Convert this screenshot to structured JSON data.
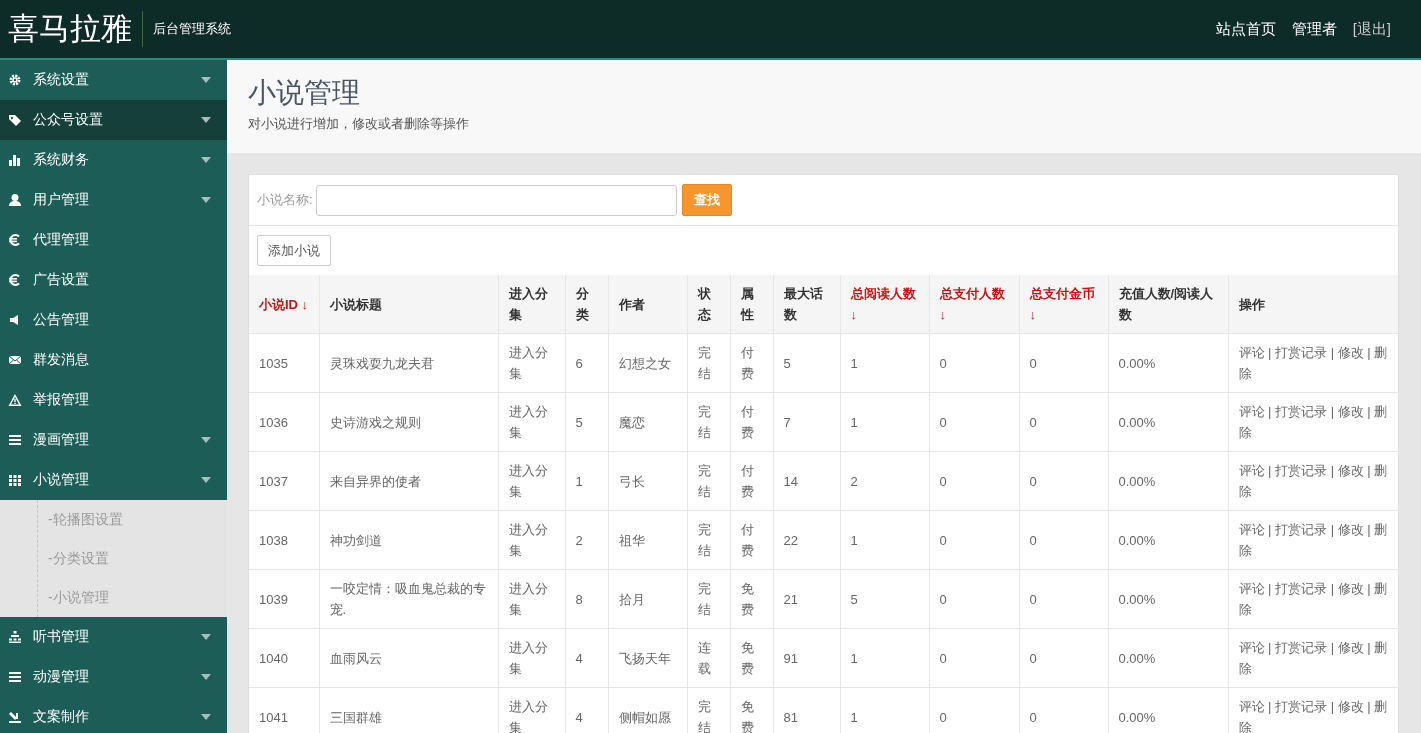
{
  "header": {
    "logo": "喜马拉雅",
    "subtitle": "后台管理系统",
    "links": [
      "站点首页",
      "管理者",
      "[退出]"
    ]
  },
  "sidebar": {
    "items": [
      {
        "label": "系统设置",
        "expandable": true,
        "selected": false
      },
      {
        "label": "公众号设置",
        "expandable": true,
        "selected": true
      },
      {
        "label": "系统财务",
        "expandable": true,
        "selected": false
      },
      {
        "label": "用户管理",
        "expandable": true,
        "selected": false
      },
      {
        "label": "代理管理",
        "expandable": false,
        "selected": false
      },
      {
        "label": "广告设置",
        "expandable": false,
        "selected": false
      },
      {
        "label": "公告管理",
        "expandable": false,
        "selected": false
      },
      {
        "label": "群发消息",
        "expandable": false,
        "selected": false
      },
      {
        "label": "举报管理",
        "expandable": false,
        "selected": false
      },
      {
        "label": "漫画管理",
        "expandable": true,
        "selected": false
      },
      {
        "label": "小说管理",
        "expandable": true,
        "selected": false,
        "expanded": true,
        "children": [
          {
            "label": "-轮播图设置"
          },
          {
            "label": "-分类设置"
          },
          {
            "label": "-小说管理"
          }
        ]
      },
      {
        "label": "听书管理",
        "expandable": true,
        "selected": false
      },
      {
        "label": "动漫管理",
        "expandable": true,
        "selected": false
      },
      {
        "label": "文案制作",
        "expandable": true,
        "selected": false
      }
    ]
  },
  "page": {
    "title": "小说管理",
    "description": "对小说进行增加，修改或者删除等操作"
  },
  "search": {
    "label": "小说名称:",
    "button": "查找"
  },
  "add_button": "添加小说",
  "table": {
    "columns": [
      {
        "label": "小说ID ↓",
        "sortable": true
      },
      {
        "label": "小说标题",
        "sortable": false
      },
      {
        "label": "进入分集",
        "sortable": false
      },
      {
        "label": "分类",
        "sortable": false
      },
      {
        "label": "作者",
        "sortable": false
      },
      {
        "label": "状态",
        "sortable": false
      },
      {
        "label": "属性",
        "sortable": false
      },
      {
        "label": "最大话数",
        "sortable": false
      },
      {
        "label": "总阅读人数 ↓",
        "sortable": true
      },
      {
        "label": "总支付人数 ↓",
        "sortable": true
      },
      {
        "label": "总支付金币 ↓",
        "sortable": true
      },
      {
        "label": "充值人数/阅读人数",
        "sortable": false
      },
      {
        "label": "操作",
        "sortable": false
      }
    ],
    "rows": [
      [
        "1035",
        "灵珠戏耍九龙夫君",
        "进入分集",
        "6",
        "幻想之女",
        "完结",
        "付费",
        "5",
        "1",
        "0",
        "0",
        "0.00%",
        "评论 | 打赏记录 | 修改 | 删除"
      ],
      [
        "1036",
        "史诗游戏之规则",
        "进入分集",
        "5",
        "魔恋",
        "完结",
        "付费",
        "7",
        "1",
        "0",
        "0",
        "0.00%",
        "评论 | 打赏记录 | 修改 | 删除"
      ],
      [
        "1037",
        "来自异界的使者",
        "进入分集",
        "1",
        "弓长",
        "完结",
        "付费",
        "14",
        "2",
        "0",
        "0",
        "0.00%",
        "评论 | 打赏记录 | 修改 | 删除"
      ],
      [
        "1038",
        "神功剑道",
        "进入分集",
        "2",
        "祖华",
        "完结",
        "付费",
        "22",
        "1",
        "0",
        "0",
        "0.00%",
        "评论 | 打赏记录 | 修改 | 删除"
      ],
      [
        "1039",
        "一咬定情：吸血鬼总裁的专宠.",
        "进入分集",
        "8",
        "拾月",
        "完结",
        "免费",
        "21",
        "5",
        "0",
        "0",
        "0.00%",
        "评论 | 打赏记录 | 修改 | 删除"
      ],
      [
        "1040",
        "血雨风云",
        "进入分集",
        "4",
        "飞扬天年",
        "连载",
        "免费",
        "91",
        "1",
        "0",
        "0",
        "0.00%",
        "评论 | 打赏记录 | 修改 | 删除"
      ],
      [
        "1041",
        "三国群雄",
        "进入分集",
        "4",
        "侧帽如愿",
        "完结",
        "免费",
        "81",
        "1",
        "0",
        "0",
        "0.00%",
        "评论 | 打赏记录 | 修改 | 删除"
      ]
    ]
  }
}
